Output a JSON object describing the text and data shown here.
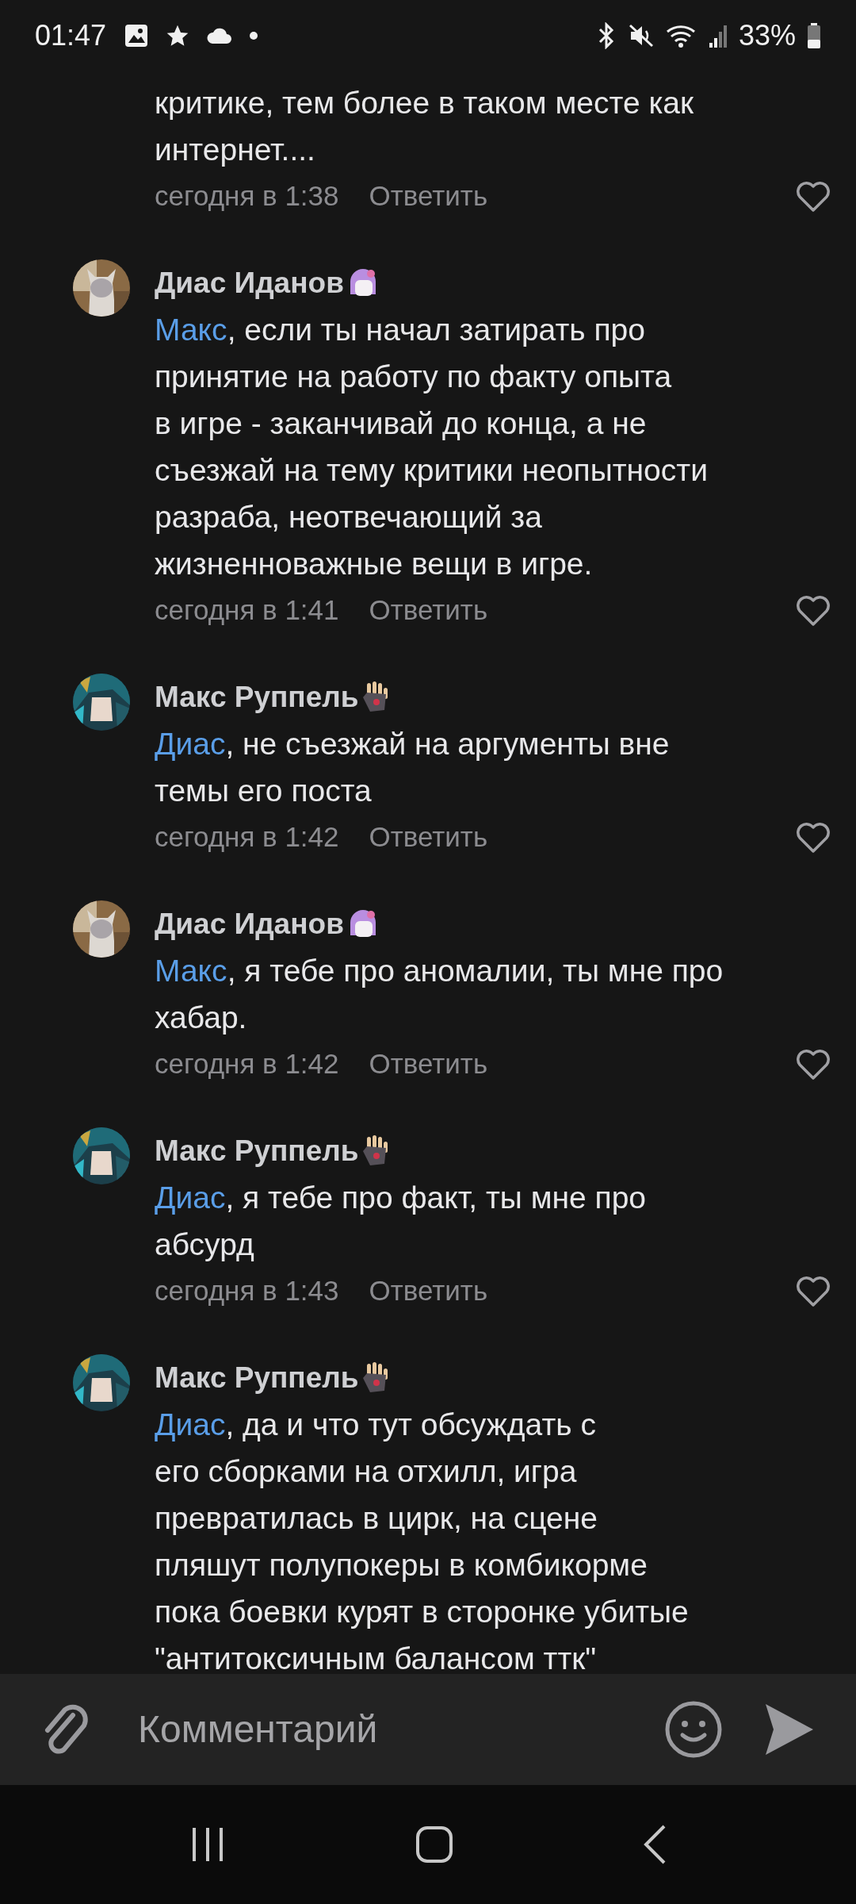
{
  "status_bar": {
    "time": "01:47",
    "battery": "33%"
  },
  "comments": [
    {
      "kind": "continued",
      "text": "критике, тем более в таком месте как\nинтернет....",
      "time": "сегодня в 1:38",
      "reply": "Ответить",
      "liked": false
    },
    {
      "kind": "cat_avatar",
      "author": "Диас Иданов",
      "mention": "Макс",
      "text": ", если ты начал затирать про\nпринятие на работу по факту опыта\nв игре  - заканчивай до конца, а не\nсъезжай на тему критики неопытности\nразраба, неотвечающий за\nжизненноважные вещи в игре.",
      "time": "сегодня в 1:41",
      "reply": "Ответить",
      "liked": false
    },
    {
      "kind": "figure_avatar",
      "author": "Макс Руппель",
      "mention": "Диас",
      "text": ", не съезжай на аргументы вне\nтемы его поста",
      "time": "сегодня в 1:42",
      "reply": "Ответить",
      "liked": false
    },
    {
      "kind": "cat_avatar",
      "author": "Диас Иданов",
      "mention": "Макс",
      "text": ", я тебе про аномалии, ты мне про\nхабар.",
      "time": "сегодня в 1:42",
      "reply": "Ответить",
      "liked": false
    },
    {
      "kind": "figure_avatar",
      "author": "Макс Руппель",
      "mention": "Диас",
      "text": ", я тебе про факт, ты мне про\nабсурд",
      "time": "сегодня в 1:43",
      "reply": "Ответить",
      "liked": false
    },
    {
      "kind": "figure_avatar",
      "author": "Макс Руппель",
      "mention": "Диас",
      "text": ", да и что тут обсуждать с\nего сборками на отхилл, игра\nпревратилась в цирк, на сцене\nпляшут полупокеры в комбикорме\nпока боевки курят в сторонке убитые\n\"антитоксичным балансом ттк\""
    }
  ],
  "composer": {
    "placeholder": "Комментарий"
  }
}
